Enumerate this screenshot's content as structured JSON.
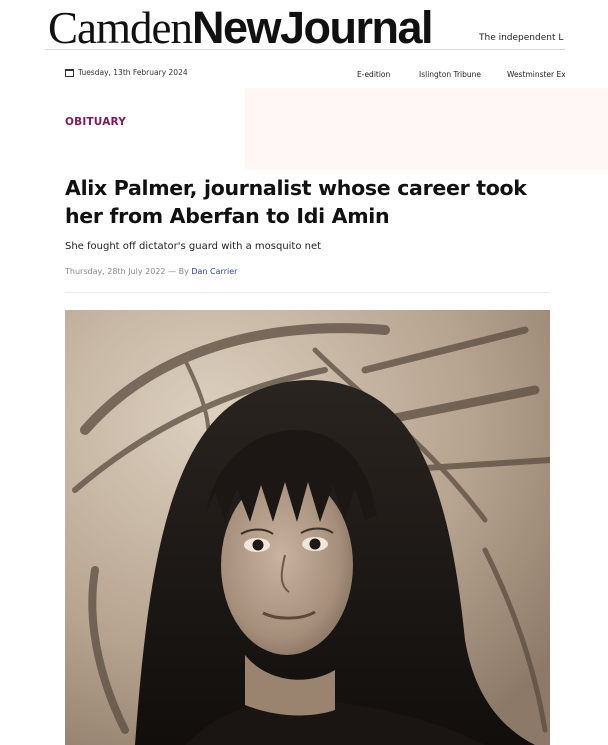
{
  "masthead": {
    "logo_part1": "Camden",
    "logo_part2": "NewJournal",
    "tagline": "The independent L"
  },
  "topbar": {
    "date": "Tuesday, 13th February 2024",
    "links": [
      "E-edition",
      "Islington Tribune",
      "Westminster Ex"
    ]
  },
  "article": {
    "section": "OBITUARY",
    "headline": "Alix Palmer, journalist whose career took her from Aberfan to Idi Amin",
    "standfirst": "She fought off dictator's guard with a mosquito net",
    "date": "Thursday, 28th July 2022",
    "byline_separator": "— By",
    "author": "Dan Carrier"
  },
  "colors": {
    "section_accent": "#7d1a5a",
    "author_link": "#3344aa",
    "photo_tone": "sepia"
  },
  "icons": {
    "date": "calendar-icon"
  }
}
